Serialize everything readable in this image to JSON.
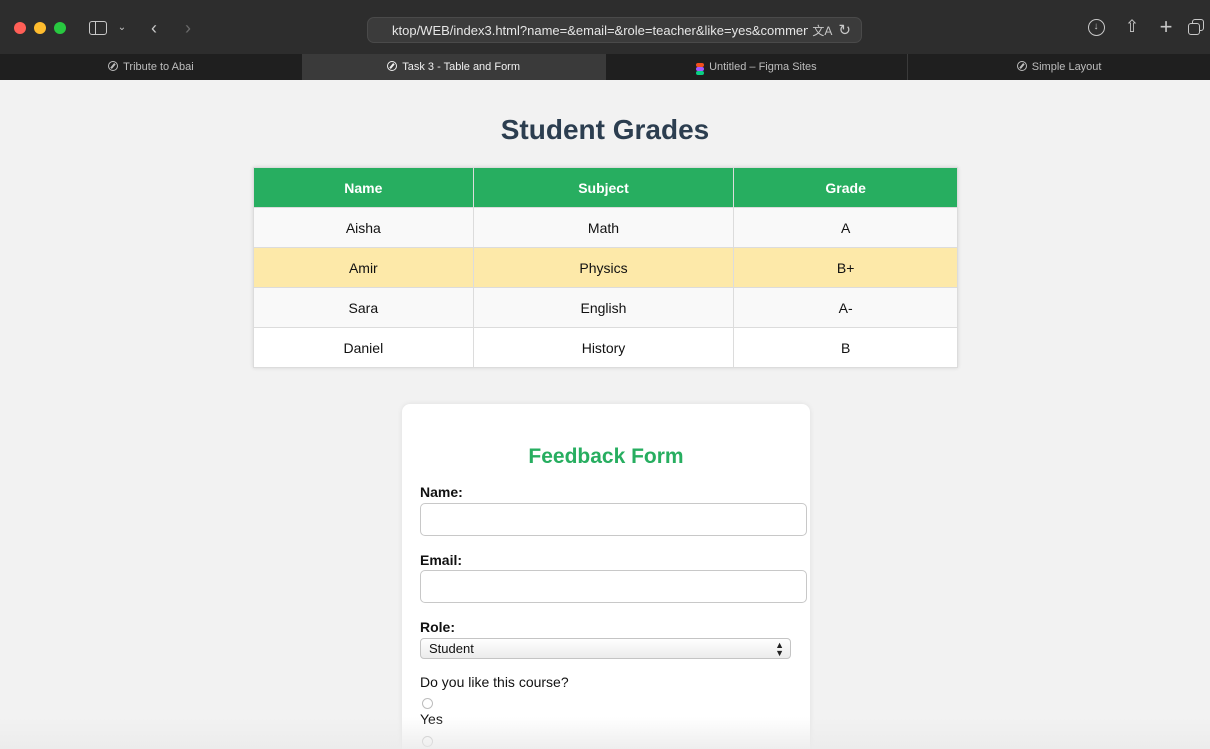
{
  "browser": {
    "address": "ktop/WEB/index3.html?name=&email=&role=teacher&like=yes&comments=",
    "icons": [
      "sidebar-icon",
      "chevron-down-icon",
      "back-arrow-icon",
      "forward-arrow-icon",
      "translate-icon",
      "reload-icon",
      "download-icon",
      "share-icon",
      "plus-icon",
      "tab-overview-icon"
    ],
    "tabs": [
      {
        "label": "Tribute to Abai",
        "icon": "compass-icon"
      },
      {
        "label": "Task 3 - Table and Form",
        "icon": "compass-icon",
        "active": true
      },
      {
        "label": "Untitled – Figma Sites",
        "icon": "figma-icon"
      },
      {
        "label": "Simple Layout",
        "icon": "compass-icon"
      }
    ]
  },
  "page": {
    "title": "Student Grades",
    "table": {
      "headers": [
        "Name",
        "Subject",
        "Grade"
      ],
      "rows": [
        [
          "Aisha",
          "Math",
          "A"
        ],
        [
          "Amir",
          "Physics",
          "B+"
        ],
        [
          "Sara",
          "English",
          "A-"
        ],
        [
          "Daniel",
          "History",
          "B"
        ]
      ],
      "header_color": "#27ae60",
      "highlight_color": "#fde9a9"
    },
    "form": {
      "title": "Feedback Form",
      "name_label": "Name:",
      "name_value": "",
      "email_label": "Email:",
      "email_value": "",
      "role_label": "Role:",
      "role_selected": "Student",
      "question": "Do you like this course?",
      "option_yes": "Yes",
      "title_color": "#27ae60"
    }
  }
}
